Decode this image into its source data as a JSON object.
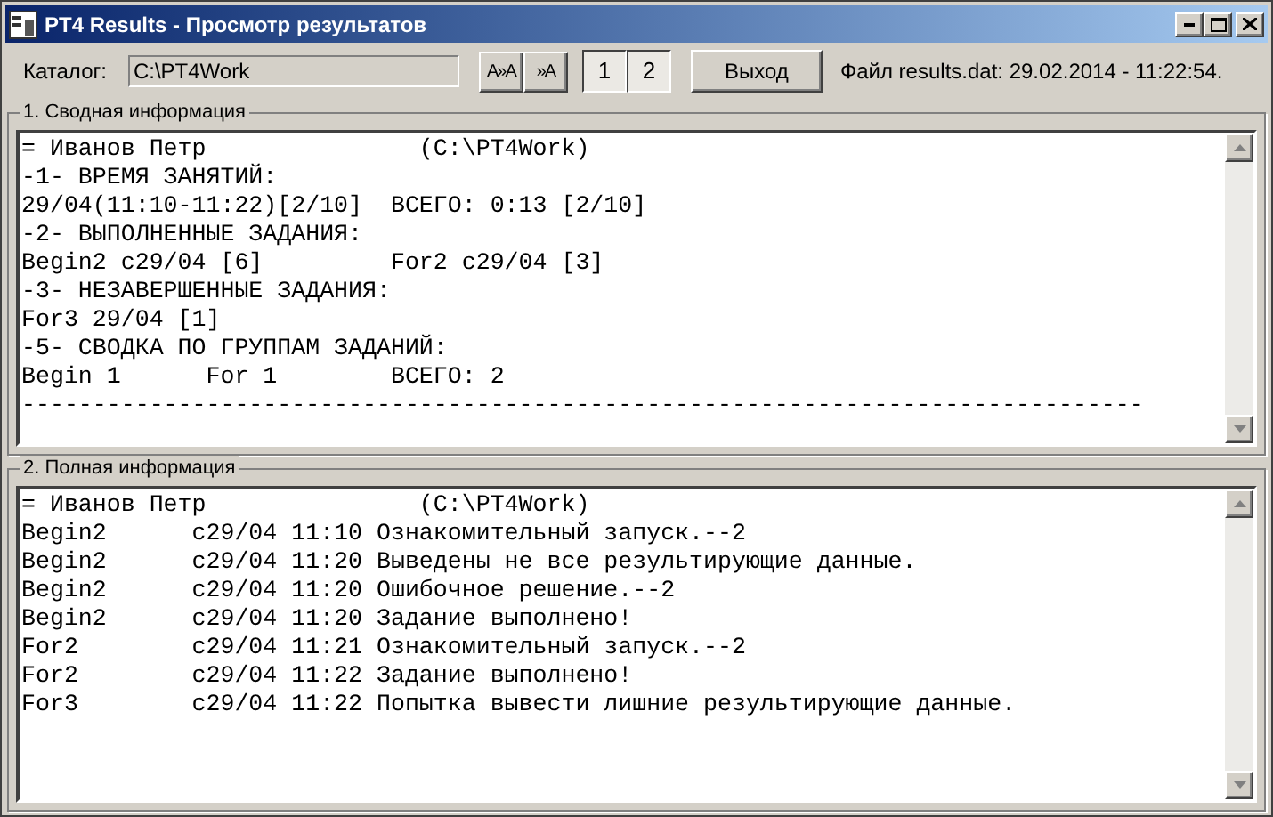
{
  "window": {
    "title": "PT4 Results - Просмотр результатов"
  },
  "toolbar": {
    "catalog_label": "Каталог:",
    "catalog_value": "C:\\PT4Work",
    "font_buttons": [
      "A»A",
      "»A"
    ],
    "pages": [
      {
        "label": "1",
        "pressed": true
      },
      {
        "label": "2",
        "pressed": true
      }
    ],
    "exit_button": "Выход",
    "file_info": "Файл results.dat: 29.02.2014 - 11:22:54."
  },
  "summary": {
    "title": "1. Сводная информация",
    "lines": [
      "= Иванов Петр               (C:\\PT4Work)",
      "-1- ВРЕМЯ ЗАНЯТИЙ:",
      "29/04(11:10-11:22)[2/10]  ВСЕГО: 0:13 [2/10]",
      "-2- ВЫПОЛНЕННЫЕ ЗАДАНИЯ:",
      "Begin2 c29/04 [6]         For2 c29/04 [3]",
      "-3- НЕЗАВЕРШЕННЫЕ ЗАДАНИЯ:",
      "For3 29/04 [1]",
      "-5- СВОДКА ПО ГРУППАМ ЗАДАНИЙ:",
      "Begin 1      For 1        ВСЕГО: 2",
      "-------------------------------------------------------------------------------"
    ]
  },
  "full": {
    "title": "2. Полная информация",
    "lines": [
      "= Иванов Петр               (C:\\PT4Work)",
      "Begin2      c29/04 11:10 Ознакомительный запуск.--2",
      "Begin2      c29/04 11:20 Выведены не все результирующие данные.",
      "Begin2      c29/04 11:20 Ошибочное решение.--2",
      "Begin2      c29/04 11:20 Задание выполнено!",
      "For2        c29/04 11:21 Ознакомительный запуск.--2",
      "For2        c29/04 11:22 Задание выполнено!",
      "For3        c29/04 11:22 Попытка вывести лишние результирующие данные."
    ]
  }
}
